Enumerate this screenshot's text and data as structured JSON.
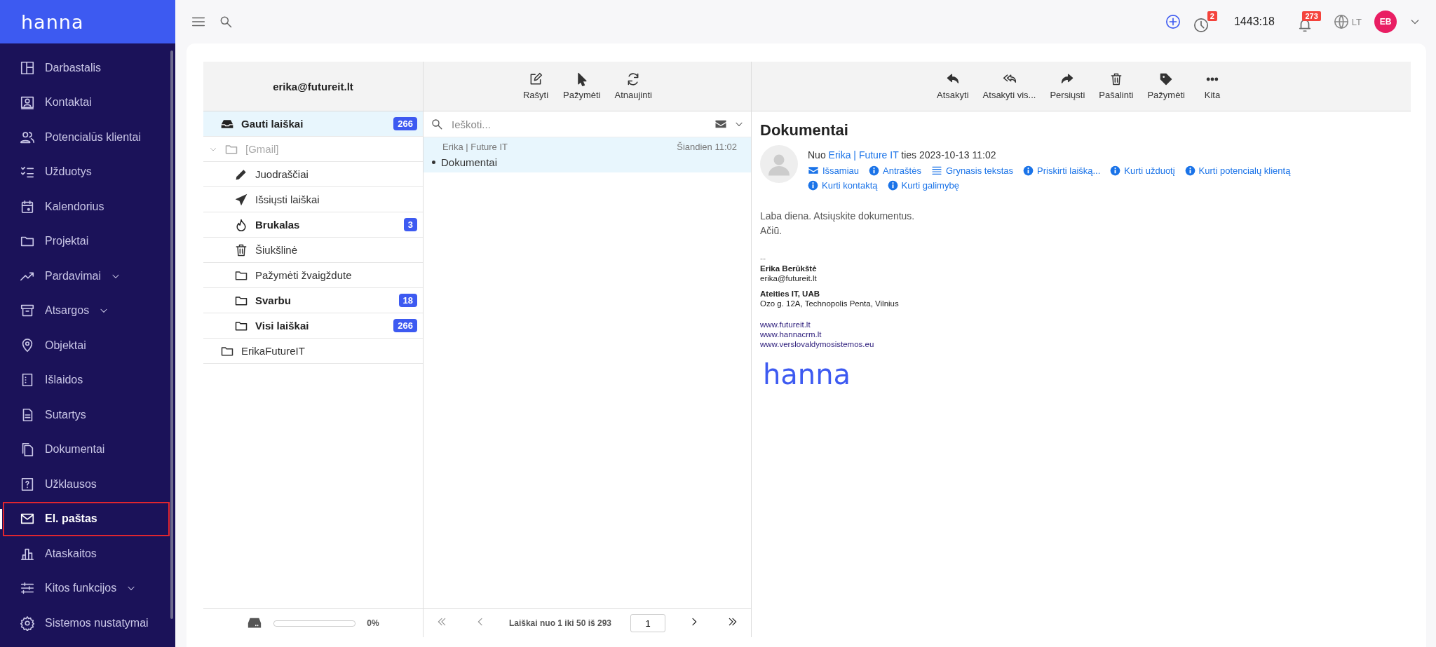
{
  "brand": {
    "logo": "hanna"
  },
  "sidebar": {
    "items": [
      {
        "label": "Darbastalis",
        "kind": "link",
        "selected": false
      },
      {
        "label": "Kontaktai",
        "kind": "link",
        "selected": false
      },
      {
        "label": "Potencialūs klientai",
        "kind": "link",
        "selected": false
      },
      {
        "label": "Užduotys",
        "kind": "link",
        "selected": false
      },
      {
        "label": "Kalendorius",
        "kind": "link",
        "selected": false
      },
      {
        "label": "Projektai",
        "kind": "link",
        "selected": false
      },
      {
        "label": "Pardavimai",
        "kind": "group",
        "selected": false
      },
      {
        "label": "Atsargos",
        "kind": "group",
        "selected": false
      },
      {
        "label": "Objektai",
        "kind": "link",
        "selected": false
      },
      {
        "label": "Išlaidos",
        "kind": "link",
        "selected": false
      },
      {
        "label": "Sutartys",
        "kind": "link",
        "selected": false
      },
      {
        "label": "Dokumentai",
        "kind": "link",
        "selected": false
      },
      {
        "label": "Užklausos",
        "kind": "link",
        "selected": false
      },
      {
        "label": "El. paštas",
        "kind": "link",
        "selected": true
      },
      {
        "label": "Ataskaitos",
        "kind": "link",
        "selected": false
      },
      {
        "label": "Kitos funkcijos",
        "kind": "group",
        "selected": false
      },
      {
        "label": "Sistemos nustatymai",
        "kind": "link",
        "selected": false
      }
    ]
  },
  "topbar": {
    "timer_badge": "2",
    "timer": "1443:18",
    "notifications_badge": "273",
    "language": "LT",
    "avatar": "EB"
  },
  "mail": {
    "account": "erika@futureit.lt",
    "folders": [
      {
        "label": "Gauti laiškai",
        "kind": "inbox",
        "count": "266",
        "selected": true
      },
      {
        "label": "[Gmail]",
        "kind": "group",
        "expanded": true,
        "selected": false,
        "children": [
          {
            "label": "Juodraščiai",
            "kind": "drafts",
            "selected": false
          },
          {
            "label": "Išsiųsti laiškai",
            "kind": "sent",
            "selected": false
          },
          {
            "label": "Brukalas",
            "kind": "spam",
            "count": "3",
            "selected": false
          },
          {
            "label": "Šiukšlinė",
            "kind": "trash",
            "selected": false
          },
          {
            "label": "Pažymėti žvaigždute",
            "kind": "folder",
            "selected": false
          },
          {
            "label": "Svarbu",
            "kind": "folder",
            "count": "18",
            "selected": false
          },
          {
            "label": "Visi laiškai",
            "kind": "folder",
            "count": "266",
            "selected": false
          }
        ]
      },
      {
        "label": "ErikaFutureIT",
        "kind": "folder",
        "selected": false
      }
    ],
    "storage": {
      "level": 0,
      "reading": "0%"
    },
    "list_toolbar": [
      "Rašyti",
      "Pažymėti",
      "Atnaujinti"
    ],
    "search": {
      "placeholder": "Ieškoti..."
    },
    "messages": [
      {
        "sender": "Erika | Future IT",
        "time": "Šiandien 11:02",
        "subject": "Dokumentai",
        "unread": true,
        "selected": true
      }
    ],
    "pager": {
      "summary": "Laiškai nuo 1 iki 50 iš 293",
      "page": "1"
    },
    "reader_toolbar": [
      "Atsakyti",
      "Atsakyti vis...",
      "Persiųsti",
      "Pašalinti",
      "Pažymėti",
      "Kita"
    ],
    "message": {
      "subject": "Dokumentai",
      "from_prefix": "Nuo",
      "from": "Erika | Future IT",
      "from_suffix": "ties 2023-10-13 11:02",
      "actions": [
        {
          "label": "Išsamiau",
          "kind": "envelope"
        },
        {
          "label": "Antraštės",
          "kind": "info"
        },
        {
          "label": "Grynasis tekstas",
          "kind": "lines"
        },
        {
          "label": "Priskirti laišką...",
          "kind": "info"
        },
        {
          "label": "Kurti užduotį",
          "kind": "info"
        },
        {
          "label": "Kurti potencialų klientą",
          "kind": "info"
        },
        {
          "label": "Kurti kontaktą",
          "kind": "info"
        },
        {
          "label": "Kurti galimybę",
          "kind": "info"
        }
      ],
      "body": [
        "Laba diena. Atsiųskite dokumentus.",
        "Ačiū."
      ],
      "separator": "--",
      "signature": {
        "name": "Erika Berūkštė",
        "email": "erika@futureit.lt",
        "company": "Ateities IT, UAB",
        "address": "Ozo g. 12A, Technopolis Penta, Vilnius",
        "links": [
          "www.futureit.lt",
          "www.hannacrm.lt",
          "www.verslovaldymosistemos.eu"
        ],
        "logo": "hanna"
      }
    }
  }
}
